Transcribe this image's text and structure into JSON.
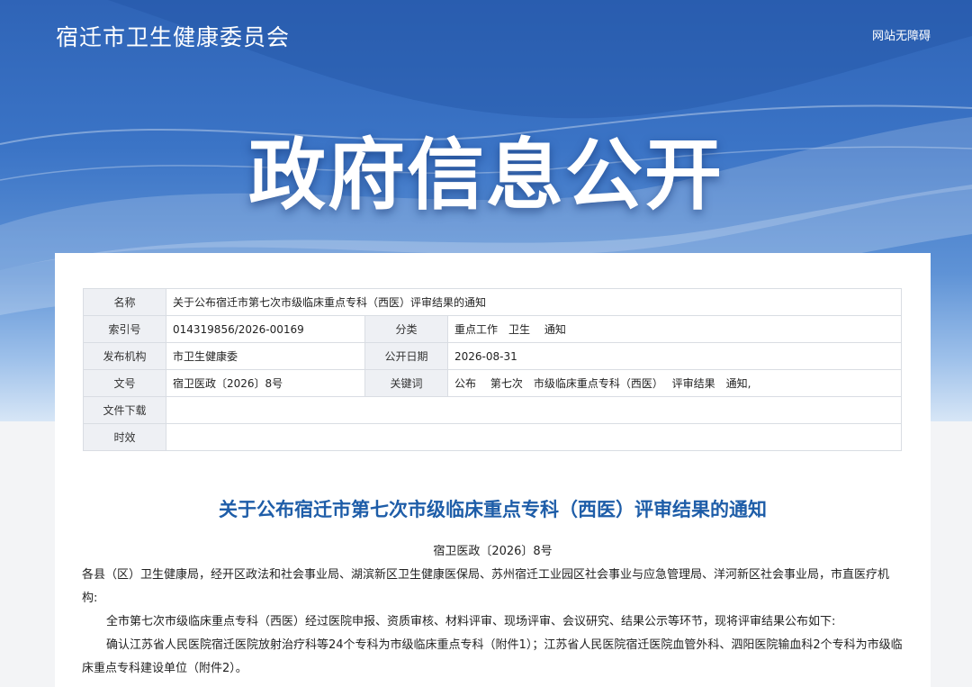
{
  "header": {
    "site_name": "宿迁市卫生健康委员会",
    "accessibility_link": "网站无障碍",
    "hero_title": "政府信息公开"
  },
  "meta": {
    "name_label": "名称",
    "name_value": "关于公布宿迁市第七次市级临床重点专科（西医）评审结果的通知",
    "index_label": "索引号",
    "index_value": "014319856/2026-00169",
    "category_label": "分类",
    "category_value": "重点工作　卫生　 通知",
    "publisher_label": "发布机构",
    "publisher_value": "市卫生健康委",
    "date_label": "公开日期",
    "date_value": "2026-08-31",
    "docno_label": "文号",
    "docno_value": "宿卫医政〔2026〕8号",
    "keywords_label": "关键词",
    "keywords_value": "公布　 第七次　市级临床重点专科（西医）　 评审结果　通知,",
    "download_label": "文件下载",
    "download_value": "",
    "validity_label": "时效",
    "validity_value": ""
  },
  "article": {
    "title": "关于公布宿迁市第七次市级临床重点专科（西医）评审结果的通知",
    "doc_number": "宿卫医政〔2026〕8号",
    "addressee": "各县（区）卫生健康局，经开区政法和社会事业局、湖滨新区卫生健康医保局、苏州宿迁工业园区社会事业与应急管理局、洋河新区社会事业局，市直医疗机构:",
    "paragraph_1": "全市第七次市级临床重点专科（西医）经过医院申报、资质审核、材料评审、现场评审、会议研究、结果公示等环节，现将评审结果公布如下:",
    "paragraph_2": "确认江苏省人民医院宿迁医院放射治疗科等24个专科为市级临床重点专科（附件1）；江苏省人民医院宿迁医院血管外科、泗阳医院输血科2个专科为市级临床重点专科建设单位（附件2）。"
  },
  "colors": {
    "banner_blue": "#3b74c6",
    "title_blue": "#1e5da8",
    "label_bg": "#eef0f4"
  }
}
